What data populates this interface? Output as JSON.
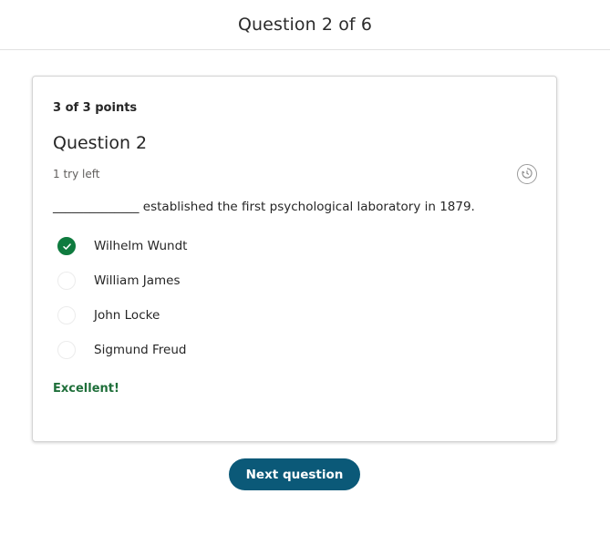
{
  "header": {
    "title": "Question 2 of 6"
  },
  "card": {
    "points": "3 of 3 points",
    "question_title": "Question 2",
    "tries_left": "1 try left",
    "history_icon": "history-icon",
    "prompt": "______________ established the first psychological laboratory in 1879.",
    "options": [
      {
        "label": "Wilhelm Wundt",
        "selected": true
      },
      {
        "label": "William James",
        "selected": false
      },
      {
        "label": "John Locke",
        "selected": false
      },
      {
        "label": "Sigmund Freud",
        "selected": false
      }
    ],
    "feedback": "Excellent!"
  },
  "footer": {
    "next_label": "Next question"
  },
  "colors": {
    "accent": "#0b5978",
    "correct": "#0f7b3f",
    "feedback": "#1f6f3a"
  }
}
